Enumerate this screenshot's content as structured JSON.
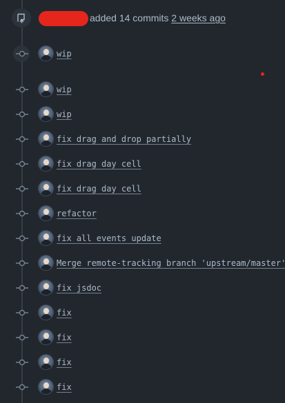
{
  "header": {
    "icon": "repo-push-icon",
    "text": "added 14 commits",
    "time": "2 weeks ago"
  },
  "commits": [
    {
      "message": "wip",
      "avatar": "user-avatar"
    },
    {
      "message": "wip",
      "avatar": "user-avatar"
    },
    {
      "message": "wip",
      "avatar": "user-avatar"
    },
    {
      "message": "fix drag and drop partially",
      "avatar": "user-avatar"
    },
    {
      "message": "fix drag day cell",
      "avatar": "user-avatar"
    },
    {
      "message": "fix drag day cell",
      "avatar": "user-avatar"
    },
    {
      "message": "refactor",
      "avatar": "user-avatar"
    },
    {
      "message": "fix all events update",
      "avatar": "user-avatar"
    },
    {
      "message": "Merge remote-tracking branch 'upstream/master'",
      "avatar": "user-avatar"
    },
    {
      "message": "fix jsdoc",
      "avatar": "user-avatar"
    },
    {
      "message": "fix",
      "avatar": "user-avatar"
    },
    {
      "message": "fix",
      "avatar": "user-avatar"
    },
    {
      "message": "fix",
      "avatar": "user-avatar"
    },
    {
      "message": "fix",
      "avatar": "user-avatar"
    }
  ],
  "colors": {
    "background": "#22272e",
    "text": "#adbac7",
    "redaction": "#e5261c",
    "timeline": "#373e47"
  }
}
